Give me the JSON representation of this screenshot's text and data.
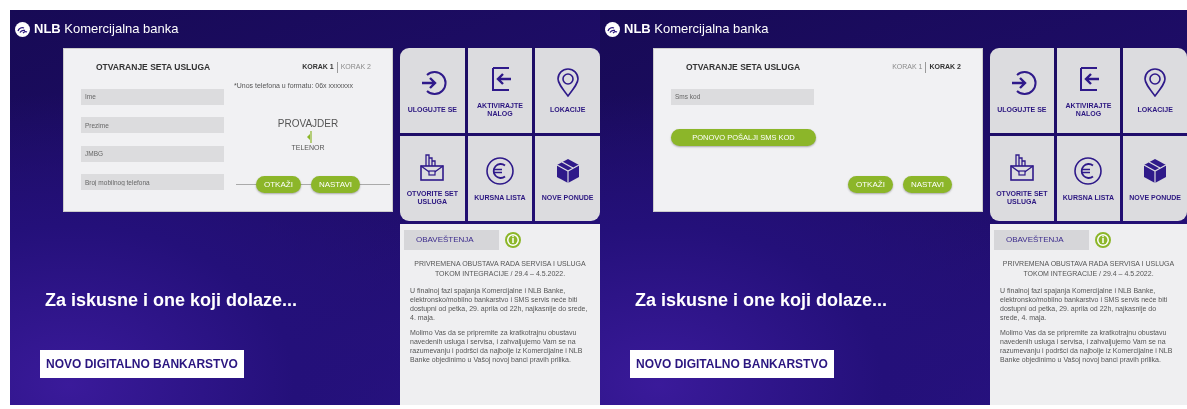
{
  "screens": [
    {
      "logo": "**NLB** Komercijalna banka",
      "form": {
        "title": "OTVARANJE SETA USLUGA",
        "steps": [
          {
            "label": "KORAK 1",
            "selected": true
          },
          {
            "label": "KORAK 2",
            "selected": false
          }
        ],
        "fields": [
          {
            "placeholder": "Ime"
          },
          {
            "placeholder": "Prezime"
          },
          {
            "placeholder": "JMBG"
          },
          {
            "placeholder": "Broj mobilnog telefona"
          }
        ],
        "hint": "*Unos telefona u formatu: 06x xxxxxxx",
        "provider": {
          "label": "PROVAJDER",
          "value": "TELENOR"
        },
        "buttons": [
          "OTKAŽI",
          "NASTAVI"
        ]
      },
      "tiles": [
        "ULOGUJTE SE",
        "AKTIVIRAJTE NALOG",
        "LOKACIJE",
        "OTVORITE SET USLUGA",
        "KURSNA LISTA",
        "NOVE PONUDE"
      ],
      "notice": {
        "title": "OBAVEŠTENJA",
        "heading": "PRIVREMENA OBUSTAVA RADA SERVISA I USLUGA TOKOM INTEGRACIJE / 29.4 – 4.5.2022.",
        "paragraphs": [
          "U finalnoj fazi spajanja Komercijalne i NLB Banke, elektronsko/mobilno bankarstvo i SMS servis neće biti dostupni od petka, 29. aprila od 22h, najkasnije do srede, 4. maja.",
          "Molimo Vas da se pripremite za kratkotrajnu obustavu navedenih usluga i servisa, i zahvaljujemo Vam se na razumevanju i podršci da najbolje iz Komercijalne i NLB Banke objedinimo u Vašoj novoj banci pravih prilika."
        ]
      },
      "tagline": "Za iskusne i one koji dolaze...",
      "badge": "NOVO DIGITALNO BANKARSTVO"
    },
    {
      "logo": "**NLB** Komercijalna banka",
      "form": {
        "title": "OTVARANJE SETA USLUGA",
        "steps": [
          {
            "label": "KORAK 1",
            "selected": false
          },
          {
            "label": "KORAK 2",
            "selected": true
          }
        ],
        "fields": [
          {
            "placeholder": "Sms kod"
          }
        ],
        "resend_button": "PONOVO POŠALJI SMS KOD",
        "buttons": [
          "OTKAŽI",
          "NASTAVI"
        ]
      },
      "tiles": [
        "ULOGUJTE SE",
        "AKTIVIRAJTE NALOG",
        "LOKACIJE",
        "OTVORITE SET USLUGA",
        "KURSNA LISTA",
        "NOVE PONUDE"
      ],
      "notice": {
        "title": "OBAVEŠTENJA",
        "heading": "PRIVREMENA OBUSTAVA RADA SERVISA I USLUGA TOKOM INTEGRACIJE / 29.4 – 4.5.2022.",
        "paragraphs": [
          "U finalnoj fazi spajanja Komercijalne i NLB Banke, elektronsko/mobilno bankarstvo i SMS servis neće biti dostupni od petka, 29. aprila od 22h, najkasnije do srede, 4. maja.",
          "Molimo Vas da se pripremite za kratkotrajnu obustavu navedenih usluga i servisa, i zahvaljujemo Vam se na razumevanju i podršci da najbolje iz Komercijalne i NLB Banke objedinimo u Vašoj novoj banci pravih prilika."
        ]
      },
      "tagline": "Za iskusne i one koji dolaze...",
      "badge": "NOVO DIGITALNO BANKARSTVO"
    }
  ]
}
